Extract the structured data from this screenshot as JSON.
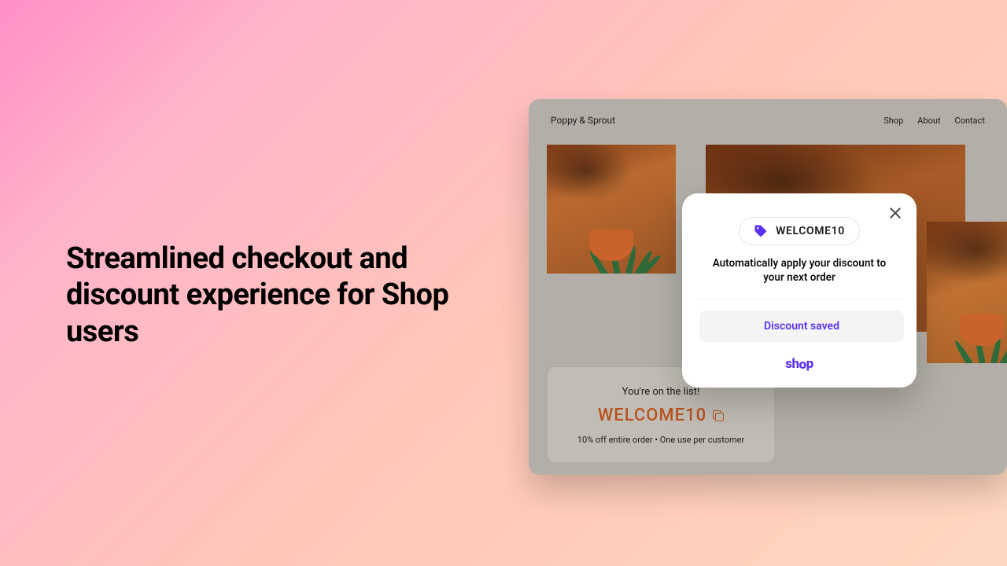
{
  "headline": "Streamlined checkout and discount experience for Shop users",
  "store": {
    "brand": "Poppy & Sprout",
    "nav": {
      "shop": "Shop",
      "about": "About",
      "contact": "Contact"
    }
  },
  "confirm": {
    "title": "You're on the list!",
    "code": "WELCOME10",
    "sub": "10% off entire order • One use per customer"
  },
  "popup": {
    "chip_code": "WELCOME10",
    "description": "Automatically apply your discount to your next order",
    "saved_label": "Discount saved",
    "logo_text": "shop"
  },
  "colors": {
    "accent_purple": "#5a31f4",
    "coupon_orange": "#b8531e"
  }
}
